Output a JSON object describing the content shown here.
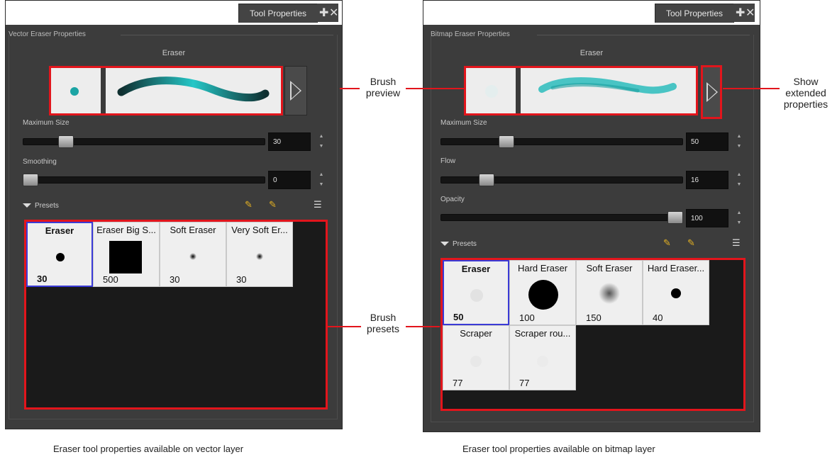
{
  "left_panel": {
    "tab_title": "Tool Properties",
    "group_title": "Vector Eraser Properties",
    "tool_name": "Eraser",
    "sliders": [
      {
        "label": "Maximum Size",
        "value": "30",
        "level": 0.17
      },
      {
        "label": "Smoothing",
        "value": "0",
        "level": 0.0
      }
    ],
    "presets_label": "Presets",
    "presets": [
      {
        "name": "Eraser",
        "size": "30",
        "selected": true,
        "dot": "hard-small"
      },
      {
        "name": "Eraser Big S...",
        "size": "500",
        "selected": false,
        "dot": "square-big"
      },
      {
        "name": "Soft Eraser",
        "size": "30",
        "selected": false,
        "dot": "soft-tiny"
      },
      {
        "name": "Very Soft Er...",
        "size": "30",
        "selected": false,
        "dot": "soft-tiny"
      }
    ],
    "caption": "Eraser tool properties available on vector layer"
  },
  "right_panel": {
    "tab_title": "Tool Properties",
    "group_title": "Bitmap Eraser Properties",
    "tool_name": "Eraser",
    "sliders": [
      {
        "label": "Maximum Size",
        "value": "50",
        "level": 0.25
      },
      {
        "label": "Flow",
        "value": "16",
        "level": 0.16
      },
      {
        "label": "Opacity",
        "value": "100",
        "level": 1.0
      }
    ],
    "presets_label": "Presets",
    "presets": [
      {
        "name": "Eraser",
        "size": "50",
        "selected": true,
        "dot": "faint"
      },
      {
        "name": "Hard Eraser",
        "size": "100",
        "selected": false,
        "dot": "hard-big"
      },
      {
        "name": "Soft Eraser",
        "size": "150",
        "selected": false,
        "dot": "soft-big"
      },
      {
        "name": "Hard Eraser...",
        "size": "40",
        "selected": false,
        "dot": "hard-medium"
      },
      {
        "name": "Scraper",
        "size": "77",
        "selected": false,
        "dot": "faint"
      },
      {
        "name": "Scraper rou...",
        "size": "77",
        "selected": false,
        "dot": "faint"
      }
    ],
    "caption": "Eraser tool properties available on bitmap layer"
  },
  "callouts": {
    "brush_preview": "Brush\npreview",
    "show_extended": "Show\nextended\nproperties",
    "brush_presets": "Brush\npresets"
  },
  "colors": {
    "highlight": "#e2151c",
    "stroke": "#1ba4a4",
    "selection": "#3a3ad6"
  },
  "icons": {
    "tab": [
      "add-icon",
      "close-icon"
    ],
    "presets_header": [
      "new-preset-icon",
      "rename-preset-icon",
      "menu-icon"
    ],
    "extended": "chevron-right-icon"
  }
}
